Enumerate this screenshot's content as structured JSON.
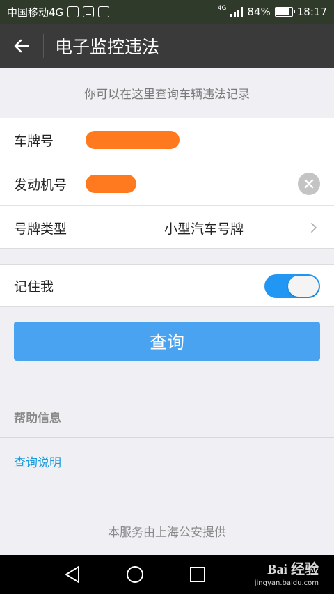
{
  "status_bar": {
    "carrier": "中国移动4G",
    "network_tag": "4G",
    "battery_percent": "84%",
    "battery_level": 0.84,
    "time": "18:17"
  },
  "header": {
    "back_icon": "back-arrow-icon",
    "title": "电子监控违法"
  },
  "subtitle": "你可以在这里查询车辆违法记录",
  "form": {
    "plate_label": "车牌号",
    "engine_label": "发动机号",
    "plate_type_label": "号牌类型",
    "plate_type_value": "小型汽车号牌",
    "redact_color": "#ff7a1f"
  },
  "remember": {
    "label": "记住我",
    "enabled": true,
    "toggle_color": "#2196f3"
  },
  "query_button": "查询",
  "help": {
    "header": "帮助信息",
    "link": "查询说明"
  },
  "footer": "本服务由上海公安提供",
  "watermark": {
    "main": "Bai 经验",
    "sub": "jingyan.baidu.com"
  },
  "colors": {
    "title_bar": "#3a3a3a",
    "accent": "#4aa3f0",
    "link": "#1a9bdc"
  }
}
